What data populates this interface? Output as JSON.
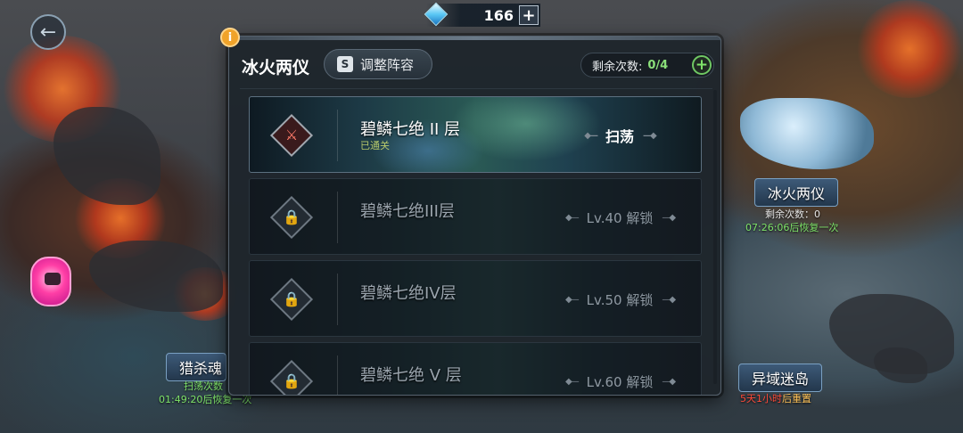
{
  "top_bar": {
    "gem_count": "166",
    "gem_icon": "diamond-icon",
    "add_icon": "plus-icon",
    "back_icon": "arrow-left-icon",
    "info_icon": "info-icon",
    "info_glyph": "i"
  },
  "map": {
    "right_node": {
      "name": "冰火两仪",
      "remaining": "剩余次数：0",
      "recover": "07:26:06后恢复一次"
    },
    "left_node": {
      "name": "猎杀魂",
      "remaining": "扫荡次数",
      "recover": "01:49:20后恢复一次"
    },
    "island_node": {
      "name": "异域迷岛",
      "reset_days": "5天1小时",
      "reset_suffix": "后重置"
    }
  },
  "dialog": {
    "title": "冰火两仪",
    "adjust_button": "调整阵容",
    "adjust_icon": "formation-icon",
    "adjust_glyph": "S",
    "remaining_label": "剩余次数:",
    "remaining_value": "0/4",
    "remaining_add": "+",
    "stages": [
      {
        "name": "碧鳞七绝 II 层",
        "status": "已通关",
        "action": "扫荡",
        "locked": false,
        "icon": "crossed-swords-icon"
      },
      {
        "name": "碧鳞七绝III层",
        "status": "",
        "action": "Lv.40 解锁",
        "locked": true,
        "icon": "lock-icon"
      },
      {
        "name": "碧鳞七绝IV层",
        "status": "",
        "action": "Lv.50 解锁",
        "locked": true,
        "icon": "lock-icon"
      },
      {
        "name": "碧鳞七绝 V 层",
        "status": "",
        "action": "Lv.60 解锁",
        "locked": true,
        "icon": "lock-icon"
      }
    ]
  },
  "colors": {
    "accent_green": "#7fe36a",
    "warning_red": "#ff4b3a",
    "info_orange": "#f0a32a"
  }
}
